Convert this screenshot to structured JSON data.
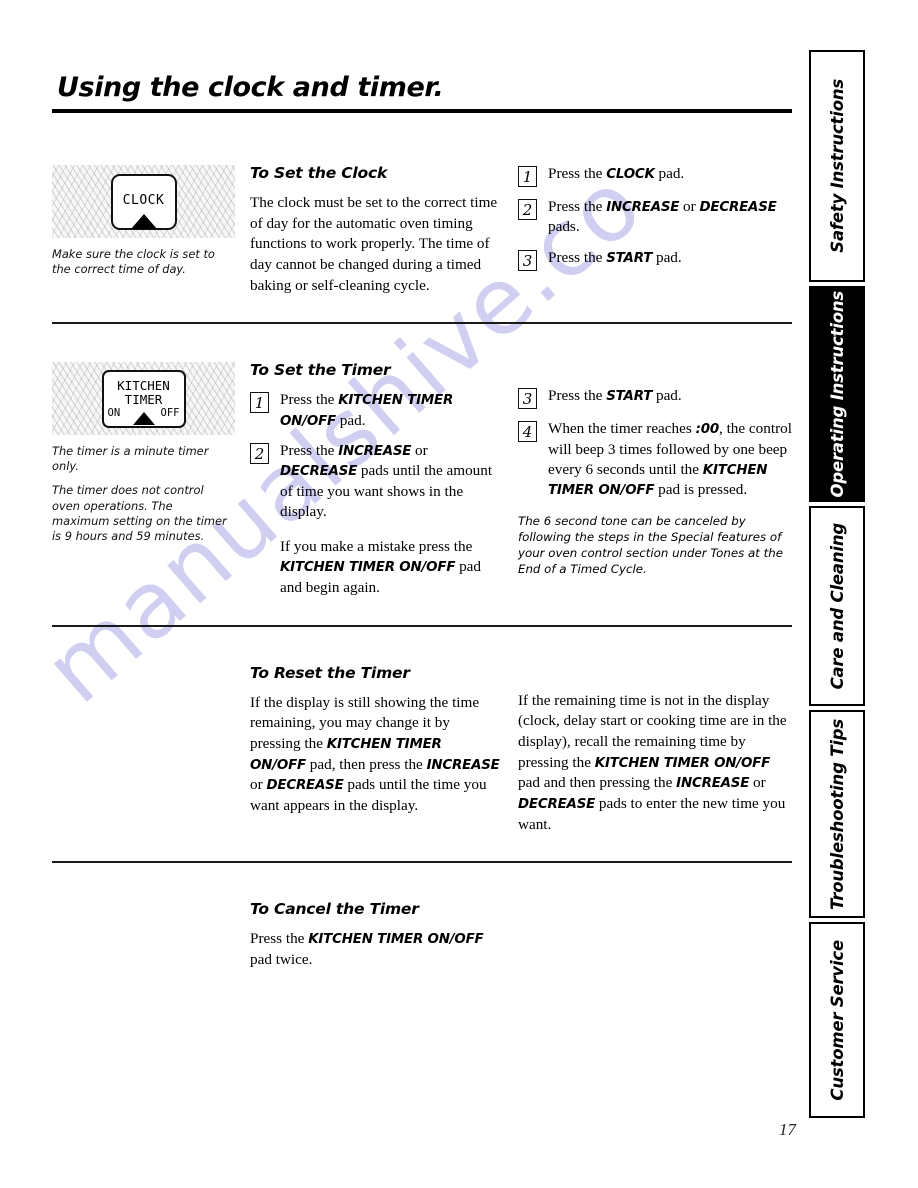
{
  "page_title": "Using the clock and timer.",
  "page_number": "17",
  "watermark": "manualshive.co",
  "sections": {
    "clock": {
      "pad": {
        "label": "CLOCK",
        "arrow": "triangle-up-icon"
      },
      "caption": [
        "Make sure the clock is set to the correct time of day."
      ],
      "heading": "To Set the Clock",
      "intro": "The clock must be set to the correct time of day for the automatic oven timing functions to work properly. The time of day cannot be changed during a timed baking or self-cleaning cycle.",
      "steps": [
        {
          "num": "1",
          "pre": "Press the ",
          "pad": "CLOCK",
          "post": " pad."
        },
        {
          "num": "2",
          "pre": "Press the ",
          "pad": "INCREASE",
          "mid": " or ",
          "pad2": "DECREASE",
          "post": " pads."
        },
        {
          "num": "3",
          "pre": "Press the ",
          "pad": "START",
          "post": " pad."
        }
      ]
    },
    "set_timer": {
      "pad": {
        "line1": "KITCHEN",
        "line2": "TIMER",
        "on": "ON",
        "off": "OFF",
        "arrow": "triangle-up-icon"
      },
      "caption": [
        "The timer is a minute timer only.",
        "The timer does not control oven operations. The maximum setting on the timer is 9 hours and 59 minutes."
      ],
      "heading": "To Set the Timer",
      "steps_left": [
        {
          "num": "1",
          "pre": "Press the ",
          "pad": "KITCHEN TIMER ON/OFF",
          "post": " pad."
        },
        {
          "num": "2",
          "pre": "Press the ",
          "pad": "INCREASE",
          "mid": " or ",
          "pad2": "DECREASE",
          "post": " pads until the amount of time you want shows in the display."
        }
      ],
      "extra_left_pre": "If you make a mistake press the ",
      "extra_left_pad": "KITCHEN TIMER ON/OFF",
      "extra_left_post": " pad and begin again.",
      "steps_right": [
        {
          "num": "3",
          "pre": "Press the ",
          "pad": "START",
          "post": " pad."
        },
        {
          "num": "4",
          "pre": "When the timer reaches ",
          "bold_inline": ":00",
          "mid": ", the control will beep 3 times followed by one beep every 6 seconds until the ",
          "pad": "KITCHEN TIMER ON/OFF",
          "post": " pad is pressed."
        }
      ],
      "note": "The 6 second tone can be canceled by following the steps in the Special features of your oven control section under Tones at the End of a Timed Cycle."
    },
    "reset_timer": {
      "heading": "To Reset the Timer",
      "left_pre": "If the display is still showing the time remaining, you may change it by pressing the ",
      "left_pad1": "KITCHEN TIMER ON/OFF",
      "left_mid1": " pad, then press the ",
      "left_pad2": "INCREASE",
      "left_mid2": " or ",
      "left_pad3": "DECREASE",
      "left_post": " pads until the time you want appears in the display.",
      "right_pre": "If the remaining time is not in the display (clock, delay start or cooking time are in the display), recall the remaining time by pressing the ",
      "right_pad1": "KITCHEN TIMER ON/OFF",
      "right_mid1": " pad and then pressing the ",
      "right_pad2": "INCREASE",
      "right_mid2": " or ",
      "right_pad3": "DECREASE",
      "right_post": " pads to enter the new time you want."
    },
    "cancel_timer": {
      "heading": "To Cancel the Timer",
      "pre": "Press the ",
      "pad": "KITCHEN TIMER ON/OFF",
      "post": " pad twice."
    }
  },
  "tabs": [
    {
      "label": "Safety Instructions",
      "active": false
    },
    {
      "label": "Operating Instructions",
      "active": true
    },
    {
      "label": "Care and Cleaning",
      "active": false
    },
    {
      "label": "Troubleshooting Tips",
      "active": false
    },
    {
      "label": "Customer Service",
      "active": false
    }
  ]
}
